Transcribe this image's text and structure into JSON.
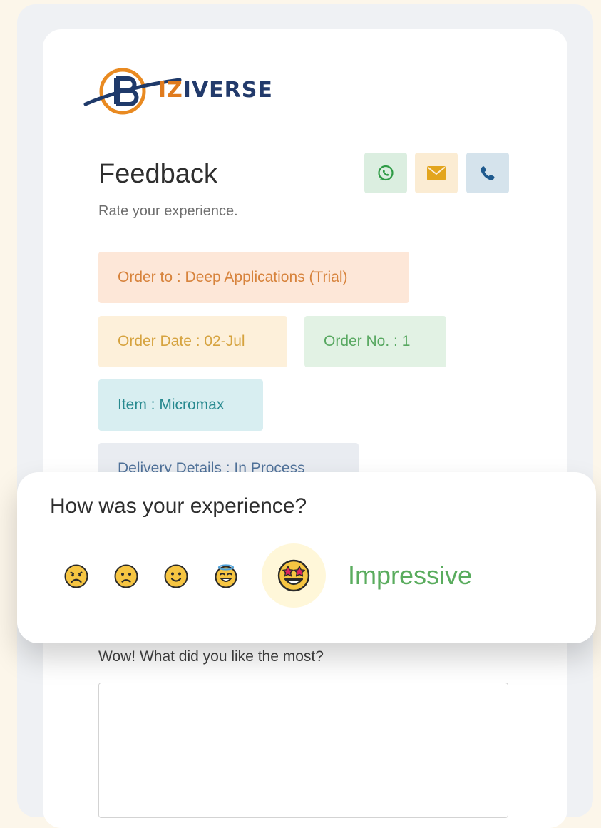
{
  "brand": {
    "logo_prefix": "B",
    "logo_middle": "IZ",
    "logo_suffix": "IVERSE"
  },
  "header": {
    "title": "Feedback",
    "subtitle": "Rate your experience."
  },
  "contact_buttons": [
    {
      "icon": "whatsapp-icon",
      "color": "#2e9b45"
    },
    {
      "icon": "email-icon",
      "color": "#e3a51d"
    },
    {
      "icon": "phone-icon",
      "color": "#1f5a8e"
    }
  ],
  "order": {
    "order_to": "Order to : Deep Applications (Trial)",
    "order_date": "Order Date : 02-Jul",
    "order_no": "Order No. : 1",
    "item": "Item : Micromax",
    "delivery": "Delivery Details : In Process"
  },
  "rating": {
    "question": "How was your experience?",
    "options": [
      {
        "icon": "very-sad-face-icon"
      },
      {
        "icon": "sad-face-icon"
      },
      {
        "icon": "smile-face-icon"
      },
      {
        "icon": "happy-face-icon"
      },
      {
        "icon": "star-struck-face-icon",
        "selected": true
      }
    ],
    "selected_label": "Impressive",
    "selected_color": "#5aac5e"
  },
  "followup": {
    "question": "Wow! What did you like the most?",
    "value": ""
  }
}
